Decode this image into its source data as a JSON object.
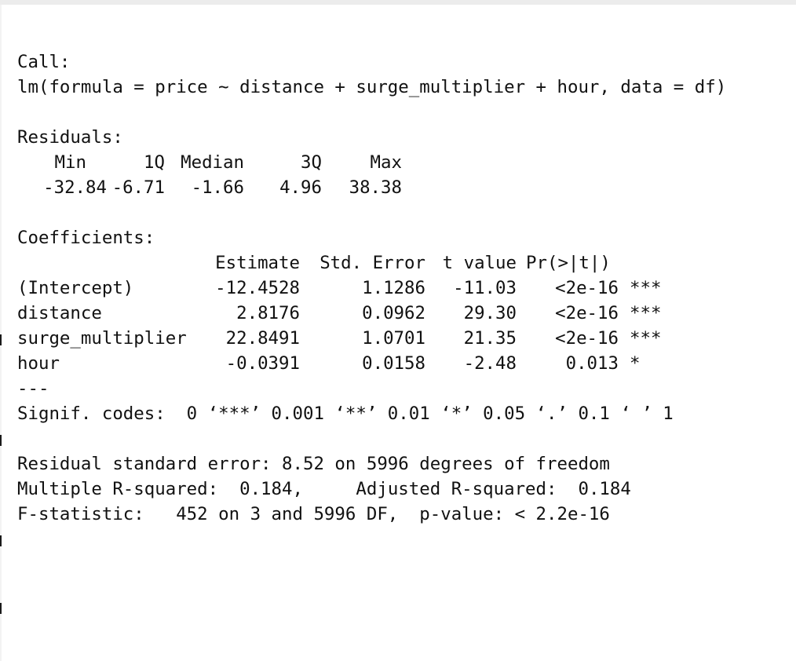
{
  "call": {
    "label": "Call:",
    "formula": "lm(formula = price ~ distance + surge_multiplier + hour, data = df)"
  },
  "residuals": {
    "label": "Residuals:",
    "headers": [
      "Min",
      "1Q",
      "Median",
      "3Q",
      "Max"
    ],
    "values": [
      "-32.84",
      "-6.71",
      "-1.66",
      "4.96",
      "38.38"
    ]
  },
  "coefficients": {
    "label": "Coefficients:",
    "headers": [
      "Estimate",
      "Std. Error",
      "t value",
      "Pr(>|t|)"
    ],
    "rows": [
      {
        "term": "(Intercept)",
        "estimate": "-12.4528",
        "std_error": "1.1286",
        "t_value": "-11.03",
        "p_value": "<2e-16",
        "signif": "***"
      },
      {
        "term": "distance",
        "estimate": "2.8176",
        "std_error": "0.0962",
        "t_value": "29.30",
        "p_value": "<2e-16",
        "signif": "***"
      },
      {
        "term": "surge_multiplier",
        "estimate": "22.8491",
        "std_error": "1.0701",
        "t_value": "21.35",
        "p_value": "<2e-16",
        "signif": "***"
      },
      {
        "term": "hour",
        "estimate": "-0.0391",
        "std_error": "0.0158",
        "t_value": "-2.48",
        "p_value": "0.013",
        "signif": "*"
      }
    ]
  },
  "separator": "---",
  "signif_codes": "Signif. codes:  0 ‘***’ 0.001 ‘**’ 0.01 ‘*’ 0.05 ‘.’ 0.1 ‘ ’ 1",
  "fit_summary": {
    "residual_se": "Residual standard error: 8.52 on 5996 degrees of freedom",
    "r_squared": "Multiple R-squared:  0.184,\tAdjusted R-squared:  0.184 ",
    "f_statistic": "F-statistic:   452 on 3 and 5996 DF,  p-value: < 2.2e-16"
  }
}
